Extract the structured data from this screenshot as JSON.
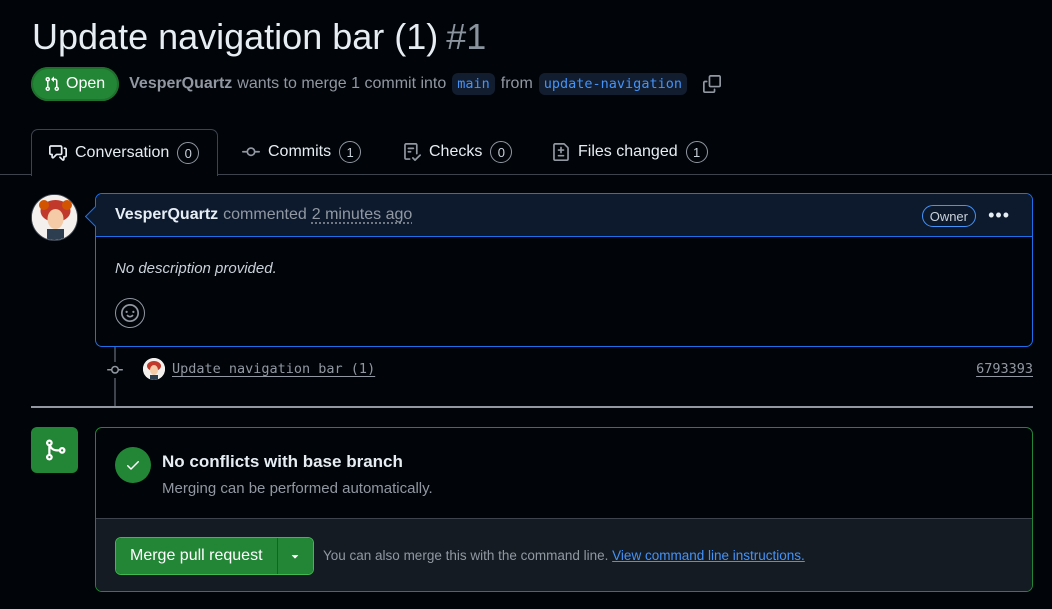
{
  "pr": {
    "title": "Update navigation bar (1)",
    "number": "#1",
    "state": "Open",
    "author": "VesperQuartz",
    "merge_text": "wants to merge 1 commit into",
    "base_branch": "main",
    "from_text": "from",
    "head_branch": "update-navigation"
  },
  "tabs": [
    {
      "label": "Conversation",
      "count": "0",
      "icon": "comment-discussion-icon"
    },
    {
      "label": "Commits",
      "count": "1",
      "icon": "git-commit-icon"
    },
    {
      "label": "Checks",
      "count": "0",
      "icon": "checklist-icon"
    },
    {
      "label": "Files changed",
      "count": "1",
      "icon": "file-diff-icon"
    }
  ],
  "comment": {
    "author": "VesperQuartz",
    "action": "commented",
    "time": "2 minutes ago",
    "role_badge": "Owner",
    "body": "No description provided."
  },
  "commit": {
    "message": "Update navigation bar (1)",
    "sha": "6793393"
  },
  "merge": {
    "title": "No conflicts with base branch",
    "subtitle": "Merging can be performed automatically.",
    "button_label": "Merge pull request",
    "hint": "You can also merge this with the command line.",
    "hint_link": "View command line instructions."
  },
  "colors": {
    "background": "#010409",
    "green": "#238636",
    "blue_accent": "#1f6feb",
    "link": "#4493f8"
  }
}
